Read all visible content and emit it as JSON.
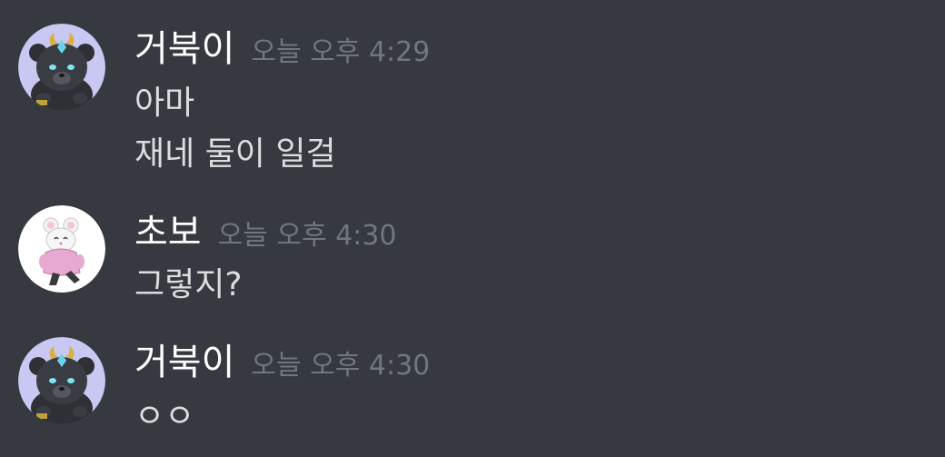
{
  "messages": [
    {
      "username": "거북이",
      "timestamp": "오늘 오후 4:29",
      "avatar_icon": "dark-bear-avatar-icon",
      "lines": [
        "아마",
        "재네 둘이 일걸"
      ]
    },
    {
      "username": "초보",
      "timestamp": "오늘 오후 4:30",
      "avatar_icon": "white-mouse-avatar-icon",
      "lines": [
        "그렇지?"
      ]
    },
    {
      "username": "거북이",
      "timestamp": "오늘 오후 4:30",
      "avatar_icon": "dark-bear-avatar-icon",
      "lines": [
        "ㅇㅇ"
      ]
    }
  ],
  "colors": {
    "background": "#36393f",
    "username": "#ffffff",
    "timestamp": "#72767d",
    "message_text": "#dcddde"
  }
}
